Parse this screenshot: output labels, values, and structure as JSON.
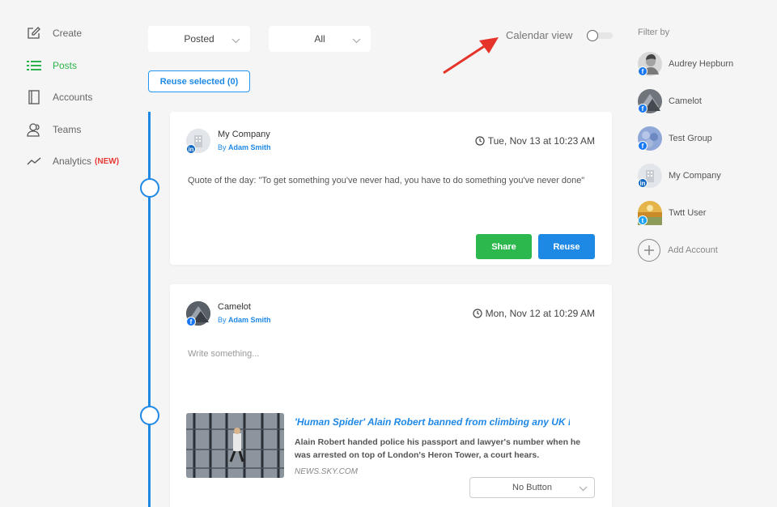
{
  "sidebar": {
    "items": [
      {
        "label": "Create",
        "icon": "edit-icon"
      },
      {
        "label": "Posts",
        "icon": "list-icon",
        "active": true
      },
      {
        "label": "Accounts",
        "icon": "book-icon"
      },
      {
        "label": "Teams",
        "icon": "users-icon"
      },
      {
        "label": "Analytics",
        "icon": "chart-line-icon",
        "badge": "(NEW)"
      }
    ]
  },
  "toolbar": {
    "status_filter": "Posted",
    "type_filter": "All",
    "reuse_selected_label": "Reuse selected (0)",
    "calendar_view_label": "Calendar view",
    "calendar_view_on": false
  },
  "posts": [
    {
      "account": "My Company",
      "by_prefix": "By",
      "author": "Adam Smith",
      "network": "linkedin",
      "time": "Tue, Nov 13 at 10:23 AM",
      "text": "Quote of the day: \"To get something you've never had, you have to do something you've never done\"",
      "share_label": "Share",
      "reuse_label": "Reuse"
    },
    {
      "account": "Camelot",
      "by_prefix": "By",
      "author": "Adam Smith",
      "network": "facebook",
      "time": "Mon, Nov 12 at 10:29 AM",
      "text_placeholder": "Write something...",
      "link": {
        "title": "'Human Spider' Alain Robert banned from climbing any UK buildir",
        "description": "Alain Robert handed police his passport and lawyer's number when he was arrested on top of London's Heron Tower, a court hears.",
        "source": "NEWS.SKY.COM",
        "button_option": "No Button"
      }
    }
  ],
  "filter": {
    "title": "Filter by",
    "accounts": [
      {
        "name": "Audrey Hepburn",
        "network": "facebook"
      },
      {
        "name": "Camelot",
        "network": "facebook"
      },
      {
        "name": "Test Group",
        "network": "facebook"
      },
      {
        "name": "My Company",
        "network": "linkedin"
      },
      {
        "name": "Twtt User",
        "network": "twitter"
      }
    ],
    "add_account_label": "Add Account"
  },
  "colors": {
    "accent": "#1e88e5",
    "active_green": "#29b34a",
    "share_green": "#2db84d",
    "new_red": "#e53935",
    "background": "#f5f5f5"
  }
}
